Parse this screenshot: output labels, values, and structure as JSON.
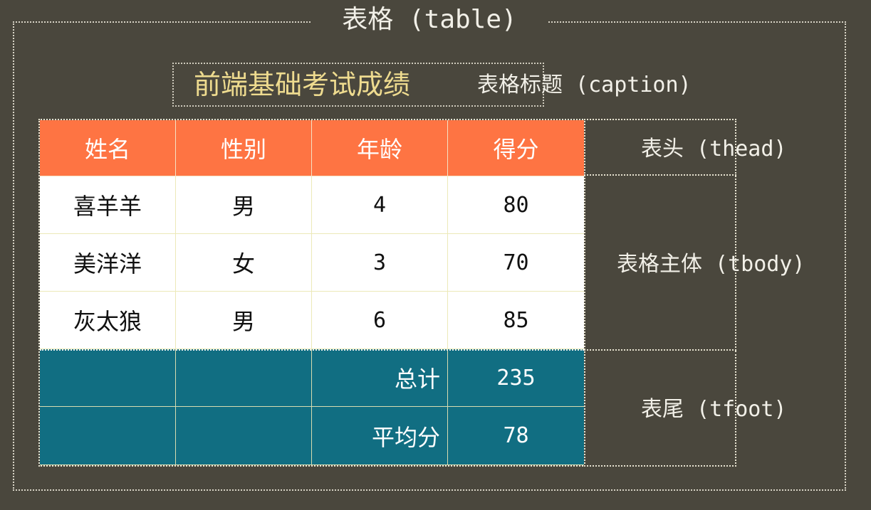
{
  "diagram": {
    "table_label": "表格 (table)",
    "caption_text": "前端基础考试成绩",
    "caption_label": "表格标题 (caption)",
    "thead_label": "表头 (thead)",
    "tbody_label": "表格主体 (tbody)",
    "tfoot_label": "表尾 (tfoot)"
  },
  "table": {
    "headers": [
      "姓名",
      "性别",
      "年龄",
      "得分"
    ],
    "rows": [
      [
        "喜羊羊",
        "男",
        "4",
        "80"
      ],
      [
        "美洋洋",
        "女",
        "3",
        "70"
      ],
      [
        "灰太狼",
        "男",
        "6",
        "85"
      ]
    ],
    "footer": [
      [
        "",
        "",
        "总计",
        "235"
      ],
      [
        "",
        "",
        "平均分",
        "78"
      ]
    ]
  },
  "colors": {
    "background": "#4a473d",
    "thead": "#fe7443",
    "tbody": "#ffffff",
    "tfoot": "#116e82",
    "caption": "#eedb8f"
  }
}
